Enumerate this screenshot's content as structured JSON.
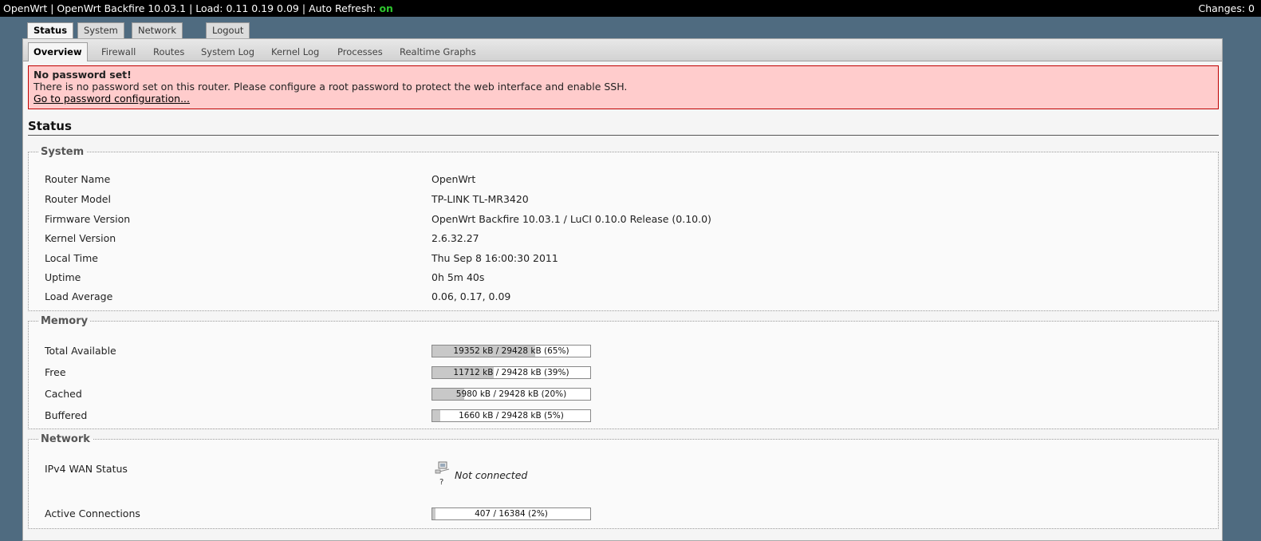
{
  "topbar": {
    "host": "OpenWrt",
    "firmware": "OpenWrt Backfire 10.03.1",
    "load_label": "Load:",
    "load": "0.11 0.19 0.09",
    "auto_refresh_label": "Auto Refresh:",
    "auto_refresh_value": "on",
    "changes": "Changes: 0"
  },
  "main_tabs": [
    "Status",
    "System",
    "Network",
    "Logout"
  ],
  "sub_tabs": [
    "Overview",
    "Firewall",
    "Routes",
    "System Log",
    "Kernel Log",
    "Processes",
    "Realtime Graphs"
  ],
  "alert": {
    "title": "No password set!",
    "message": "There is no password set on this router. Please configure a root password to protect the web interface and enable SSH.",
    "link": "Go to password configuration..."
  },
  "page_title": "Status",
  "system": {
    "legend": "System",
    "rows": [
      {
        "label": "Router Name",
        "value": "OpenWrt"
      },
      {
        "label": "Router Model",
        "value": "TP-LINK TL-MR3420"
      },
      {
        "label": "Firmware Version",
        "value": "OpenWrt Backfire 10.03.1 / LuCI 0.10.0 Release (0.10.0)"
      },
      {
        "label": "Kernel Version",
        "value": "2.6.32.27"
      },
      {
        "label": "Local Time",
        "value": "Thu Sep 8 16:00:30 2011"
      },
      {
        "label": "Uptime",
        "value": "0h 5m 40s"
      },
      {
        "label": "Load Average",
        "value": "0.06, 0.17, 0.09"
      }
    ]
  },
  "memory": {
    "legend": "Memory",
    "rows": [
      {
        "label": "Total Available",
        "text": "19352 kB / 29428 kB (65%)",
        "percent": 65
      },
      {
        "label": "Free",
        "text": "11712 kB / 29428 kB (39%)",
        "percent": 39
      },
      {
        "label": "Cached",
        "text": "5980 kB / 29428 kB (20%)",
        "percent": 20
      },
      {
        "label": "Buffered",
        "text": "1660 kB / 29428 kB (5%)",
        "percent": 5
      }
    ]
  },
  "network": {
    "legend": "Network",
    "wan_label": "IPv4 WAN Status",
    "wan_icon": "network-unknown-icon",
    "wan_icon_glyph": "?",
    "wan_status": "Not connected",
    "conn_label": "Active Connections",
    "conn_text": "407 / 16384 (2%)",
    "conn_percent": 2
  },
  "colors": {
    "background": "#4f6b80",
    "alert_bg": "#ffcccc",
    "alert_border": "#c00000",
    "refresh_on": "#2ec52e",
    "bar_fill": "#c8c8c8"
  }
}
